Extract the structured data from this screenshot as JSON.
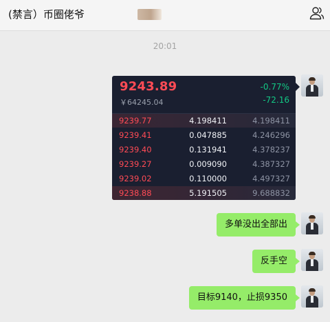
{
  "header": {
    "title": "(禁言）币圈佬爷"
  },
  "timestamp": "20:01",
  "ticker": {
    "price": "9243.89",
    "cny": "￥64245.04",
    "change_pct": "-0.77%",
    "change_abs": "-72.16",
    "rows": [
      {
        "price": "9239.77",
        "amount": "4.198411",
        "total": "4.198411"
      },
      {
        "price": "9239.41",
        "amount": "0.047885",
        "total": "4.246296"
      },
      {
        "price": "9239.40",
        "amount": "0.131941",
        "total": "4.378237"
      },
      {
        "price": "9239.27",
        "amount": "0.009090",
        "total": "4.387327"
      },
      {
        "price": "9239.02",
        "amount": "0.110000",
        "total": "4.497327"
      },
      {
        "price": "9238.88",
        "amount": "5.191505",
        "total": "9.688832"
      }
    ]
  },
  "messages": [
    {
      "text": "多单没出全部出"
    },
    {
      "text": "反手空"
    },
    {
      "text": "目标9140，止损9350"
    }
  ],
  "colors": {
    "bubble": "#95ec69",
    "price_red": "#ff4b55",
    "change_green": "#12c985",
    "panel_bg": "#1a1f30"
  },
  "icons": {
    "header_right": "people-icon"
  }
}
